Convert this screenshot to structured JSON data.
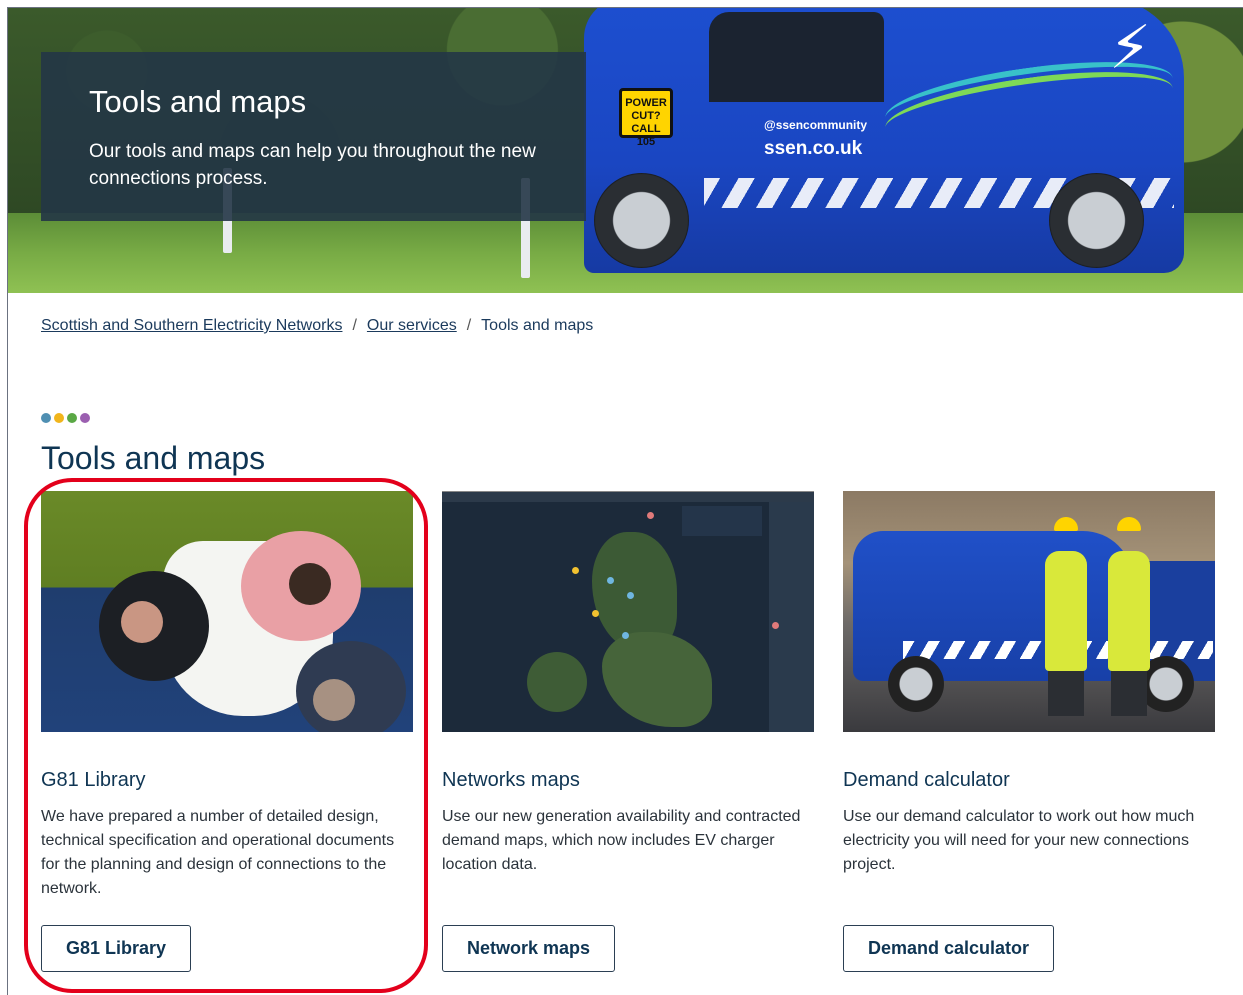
{
  "hero": {
    "title": "Tools and maps",
    "subtitle": "Our tools and maps can help you throughout the new connections process.",
    "van_sticker": "POWER CUT? CALL 105",
    "van_social": "@ssencommunity",
    "van_url": "ssen.co.uk"
  },
  "breadcrumb": {
    "items": [
      {
        "label": "Scottish and Southern Electricity Networks",
        "link": true
      },
      {
        "label": "Our services",
        "link": true
      },
      {
        "label": "Tools and maps",
        "link": false
      }
    ],
    "separator": "/"
  },
  "section": {
    "title": "Tools and maps",
    "dot_colors": [
      "#4f8fb2",
      "#f1b51c",
      "#5aa845",
      "#9b5fb0"
    ]
  },
  "cards": [
    {
      "title": "G81 Library",
      "description": "We have prepared a number of detailed design, technical specification and operational documents for the planning and design of connections to the network.",
      "button": "G81 Library"
    },
    {
      "title": "Networks maps",
      "description": "Use our new generation availability and contracted demand maps, which now includes EV charger location data.",
      "button": "Network maps"
    },
    {
      "title": "Demand calculator",
      "description": "Use our demand calculator to work out how much electricity you will need for your new connections project.",
      "button": "Demand calculator"
    }
  ],
  "colors": {
    "heading": "#0f3553",
    "annotation": "#e3001b",
    "hero_panel": "#243646"
  }
}
